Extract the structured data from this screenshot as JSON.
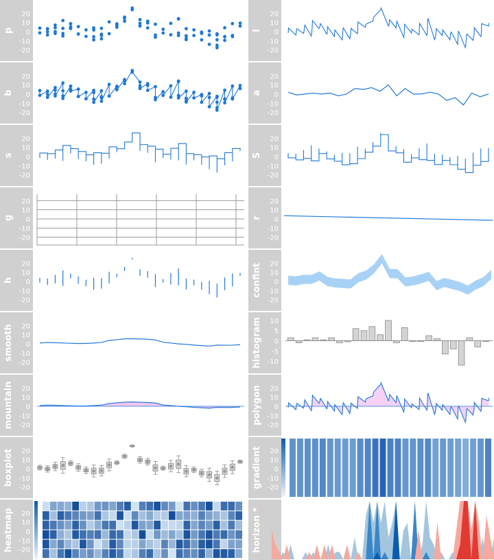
{
  "colors": {
    "line": "#1f77d8",
    "dot": "#1f77d8",
    "fill_light": "#a8d2f5",
    "pos_fill": "#f3c6f2",
    "neg_fill": "#a8e4f7",
    "panel_label_bg": "#d0d0d0",
    "panel_label_text": "#ffffff",
    "grid": "#9a9a9a",
    "hist_fill": "#d4d4d4",
    "box_fill": "#d4d4d4",
    "red_dark": "#e03a32",
    "red_light": "#f5a99f",
    "blue_dark": "#0b5cad",
    "blue_mid": "#3a86c8",
    "blue_light": "#a3c6de"
  },
  "chart_data": [
    {
      "type": "scatter",
      "panel": "p",
      "ylim": [
        -30,
        30
      ],
      "yticks": [
        "20",
        "10",
        "0",
        "-10",
        "-20"
      ],
      "series_summary": "grouped points per x",
      "category_count": 26,
      "center": [
        0,
        -1,
        2,
        1,
        2,
        0,
        -1,
        -2,
        -3,
        2,
        10,
        14,
        18,
        6,
        8,
        -2,
        4,
        1,
        2,
        -1,
        0,
        -3,
        -6,
        -10,
        -2,
        2,
        3
      ]
    },
    {
      "type": "line",
      "panel": "l",
      "ylim": [
        -30,
        30
      ],
      "yticks": [
        "20",
        "10",
        "0",
        "-10",
        "-20"
      ]
    },
    {
      "type": "line",
      "panel": "b",
      "ylim": [
        -30,
        30
      ],
      "yticks": [
        "20",
        "10",
        "0",
        "-10",
        "-20"
      ]
    },
    {
      "type": "line",
      "panel": "a",
      "ylim": [
        -30,
        30
      ],
      "yticks": [
        "20",
        "10",
        "0",
        "-10",
        "-20"
      ],
      "values": [
        2,
        -1,
        0,
        1,
        0,
        1,
        -2,
        0,
        6,
        5,
        7,
        3,
        10,
        -2,
        6,
        0,
        0,
        2,
        0,
        -7,
        -4,
        -12,
        1,
        -3,
        0
      ]
    },
    {
      "type": "line",
      "panel": "s",
      "ylim": [
        -30,
        30
      ],
      "yticks": [
        "20",
        "10",
        "0",
        "-10",
        "-20"
      ]
    },
    {
      "type": "line",
      "panel": "S",
      "ylim": [
        -30,
        30
      ],
      "yticks": [
        "20",
        "10",
        "0",
        "-10",
        "-20"
      ]
    },
    {
      "type": "line",
      "panel": "g",
      "ylim": [
        -30,
        30
      ],
      "yticks": [
        "20",
        "10",
        "0",
        "-10",
        "-20"
      ],
      "grid": true
    },
    {
      "type": "line",
      "panel": "r",
      "ylim": [
        -30,
        30
      ],
      "yticks": [
        "20",
        "10",
        "0",
        "-10",
        "-20"
      ],
      "values": [
        3.5,
        -1.5
      ]
    },
    {
      "type": "line",
      "panel": "h",
      "ylim": [
        -30,
        30
      ],
      "yticks": [
        "20",
        "10",
        "0",
        "-10",
        "-20"
      ]
    },
    {
      "type": "area",
      "panel": "confint",
      "ylim": [
        -30,
        30
      ],
      "yticks": [
        "20",
        "10",
        "0",
        "-10",
        "-20"
      ]
    },
    {
      "type": "line",
      "panel": "smooth",
      "ylim": [
        -30,
        30
      ],
      "yticks": [
        "20",
        "10",
        "0",
        "-10",
        "-20"
      ]
    },
    {
      "type": "bar",
      "panel": "histogram",
      "ylim": [
        -15,
        10
      ],
      "yticks": [
        "10",
        "5",
        "0",
        "-5",
        "-10"
      ],
      "values": [
        1.5,
        -1,
        0.5,
        1.5,
        0.5,
        1.5,
        -1,
        -0.5,
        6,
        5,
        7,
        3,
        10,
        -1,
        6.5,
        0,
        0,
        2.5,
        1,
        -6.5,
        -4,
        -12,
        1.5,
        -3,
        0
      ]
    },
    {
      "type": "area",
      "panel": "mountain",
      "ylim": [
        -30,
        30
      ],
      "yticks": [
        "20",
        "10",
        "0",
        "-10",
        "-20"
      ]
    },
    {
      "type": "area",
      "panel": "polygon",
      "ylim": [
        -30,
        30
      ],
      "yticks": [
        "20",
        "10",
        "0",
        "-10",
        "-20"
      ]
    },
    {
      "type": "bar",
      "panel": "boxplot",
      "ylim": [
        -30,
        30
      ],
      "yticks": [
        "20",
        "10",
        "0",
        "-10",
        "-20"
      ]
    },
    {
      "type": "heatmap",
      "panel": "gradient",
      "ylim": [
        -30,
        30
      ],
      "yticks": [
        "20",
        "10",
        "0",
        "-10",
        "-20"
      ]
    },
    {
      "type": "heatmap",
      "panel": "heatmap",
      "ylim": [
        -30,
        30
      ],
      "yticks": [
        "20",
        "10",
        "0",
        "-10",
        "-20"
      ]
    },
    {
      "type": "area",
      "panel": "horizon *",
      "ylim": [
        -30,
        30
      ],
      "yticks": []
    }
  ],
  "seed": {
    "y": [
      -4,
      -2,
      -1,
      1,
      -2,
      2,
      0,
      0,
      0,
      1,
      -1,
      1,
      -2,
      0,
      -2,
      2,
      -2,
      1,
      1,
      0,
      -2,
      0,
      3,
      -1,
      0,
      6,
      16,
      5,
      17,
      5,
      9,
      3,
      5,
      25,
      0,
      4,
      5,
      0,
      16,
      -4,
      2,
      9,
      3,
      2,
      -5,
      1,
      0,
      0,
      1,
      -4,
      -10,
      -20,
      -24,
      -4,
      -18,
      -5,
      3,
      -6,
      -3,
      3
    ]
  }
}
